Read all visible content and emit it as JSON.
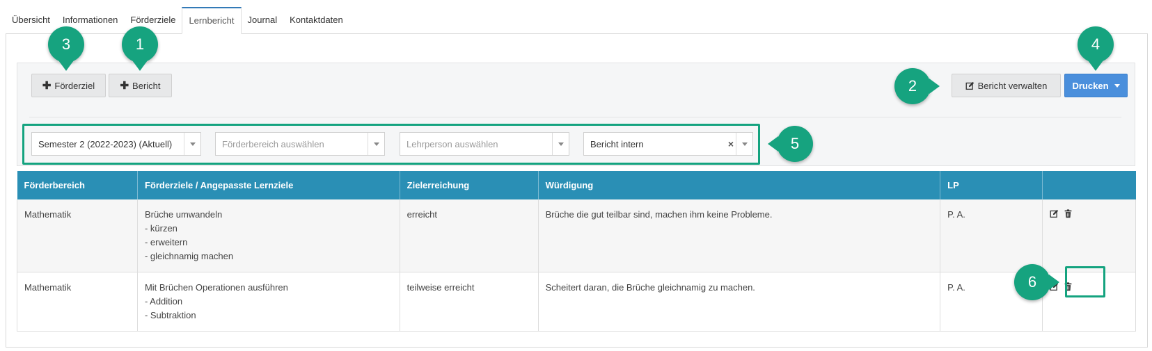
{
  "tabs": [
    {
      "label": "Übersicht",
      "active": false
    },
    {
      "label": "Informationen",
      "active": false
    },
    {
      "label": "Förderziele",
      "active": false
    },
    {
      "label": "Lernbericht",
      "active": true
    },
    {
      "label": "Journal",
      "active": false
    },
    {
      "label": "Kontaktdaten",
      "active": false
    }
  ],
  "toolbar": {
    "add_goal_label": "Förderziel",
    "add_report_label": "Bericht",
    "manage_report_label": "Bericht verwalten",
    "print_label": "Drucken"
  },
  "filters": {
    "semester": {
      "value": "Semester 2 (2022-2023) (Aktuell)"
    },
    "area": {
      "placeholder": "Förderbereich auswählen"
    },
    "teacher": {
      "placeholder": "Lehrperson auswählen"
    },
    "report_type": {
      "value": "Bericht intern",
      "clear_symbol": "×"
    }
  },
  "table": {
    "columns": [
      "Förderbereich",
      "Förderziele / Angepasste Lernziele",
      "Zielerreichung",
      "Würdigung",
      "LP",
      ""
    ],
    "rows": [
      {
        "area": "Mathematik",
        "goal_title": "Brüche umwandeln",
        "goal_items": [
          "- kürzen",
          "- erweitern",
          "- gleichnamig machen"
        ],
        "achievement": "erreicht",
        "appraisal": "Brüche die gut teilbar sind, machen ihm keine Probleme.",
        "lp": "P. A."
      },
      {
        "area": "Mathematik",
        "goal_title": "Mit Brüchen Operationen ausführen",
        "goal_items": [
          "- Addition",
          "- Subtraktion"
        ],
        "achievement": "teilweise erreicht",
        "appraisal": "Scheitert daran, die Brüche gleichnamig zu machen.",
        "lp": "P. A."
      }
    ]
  },
  "markers": [
    "1",
    "2",
    "3",
    "4",
    "5",
    "6"
  ],
  "colors": {
    "header_bg": "#2a8fb5",
    "print_button": "#4a8fdc",
    "marker": "#16a37f",
    "active_tab_top": "#337ab7"
  },
  "icons": {
    "add": "plus-icon",
    "manage": "edit-icon",
    "print_dropdown": "caret-down-icon",
    "row_edit": "edit-icon",
    "row_delete": "trash-icon",
    "select_arrow": "chevron-down-icon",
    "select_clear": "close-icon"
  }
}
